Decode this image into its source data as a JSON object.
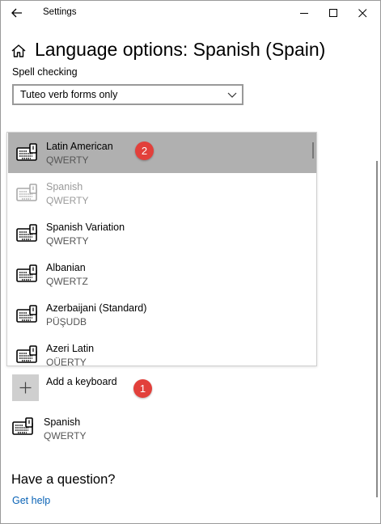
{
  "window": {
    "title": "Settings"
  },
  "header": {
    "page_title": "Language options: Spanish (Spain)"
  },
  "spell_checking": {
    "label": "Spell checking",
    "selected_value": "Tuteo verb forms only"
  },
  "keyboard_list": {
    "items": [
      {
        "name": "Latin American",
        "layout": "QWERTY",
        "state": "selected"
      },
      {
        "name": "Spanish",
        "layout": "QWERTY",
        "state": "disabled"
      },
      {
        "name": "Spanish Variation",
        "layout": "QWERTY",
        "state": "normal"
      },
      {
        "name": "Albanian",
        "layout": "QWERTZ",
        "state": "normal"
      },
      {
        "name": "Azerbaijani (Standard)",
        "layout": "PÜŞUDB",
        "state": "normal"
      },
      {
        "name": "Azeri Latin",
        "layout": "QÜERTY",
        "state": "normal"
      }
    ]
  },
  "add_keyboard": {
    "label": "Add a keyboard"
  },
  "installed_keyboard": {
    "name": "Spanish",
    "layout": "QWERTY"
  },
  "help": {
    "heading": "Have a question?",
    "link": "Get help"
  },
  "annotations": {
    "badge_1": "1",
    "badge_2": "2"
  },
  "colors": {
    "accent_link": "#0a63b6",
    "selected_row": "#b0b0b0",
    "badge": "#e2403b"
  }
}
